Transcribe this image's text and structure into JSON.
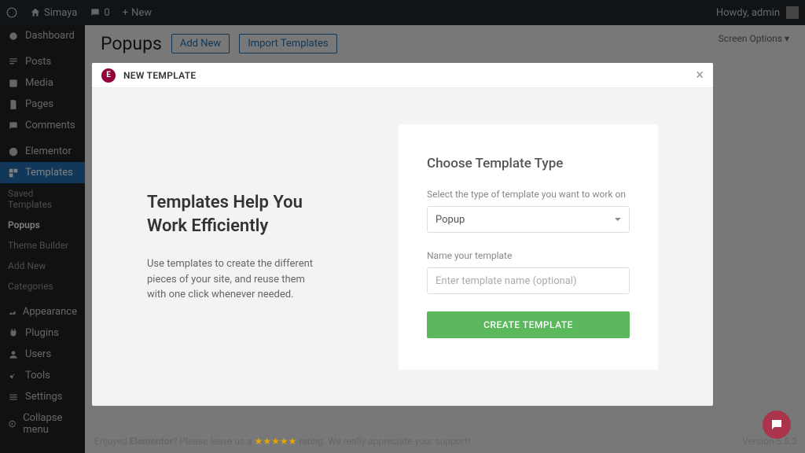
{
  "topbar": {
    "site_name": "Simaya",
    "comments_count": "0",
    "new_label": "New",
    "howdy": "Howdy, admin"
  },
  "sidebar": {
    "dashboard": "Dashboard",
    "posts": "Posts",
    "media": "Media",
    "pages": "Pages",
    "comments": "Comments",
    "elementor": "Elementor",
    "templates": "Templates",
    "saved_templates": "Saved Templates",
    "popups": "Popups",
    "theme_builder": "Theme Builder",
    "add_new": "Add New",
    "categories": "Categories",
    "appearance": "Appearance",
    "plugins": "Plugins",
    "users": "Users",
    "tools": "Tools",
    "settings": "Settings",
    "collapse": "Collapse menu"
  },
  "page": {
    "title": "Popups",
    "add_new": "Add New",
    "import": "Import Templates",
    "screen_options": "Screen Options"
  },
  "modal": {
    "header": "NEW TEMPLATE",
    "left_heading_1": "Templates Help You",
    "left_heading_2": "Work Efficiently",
    "left_desc": "Use templates to create the different pieces of your site, and reuse them with one click whenever needed.",
    "form_heading": "Choose Template Type",
    "type_label": "Select the type of template you want to work on",
    "type_value": "Popup",
    "name_label": "Name your template",
    "name_placeholder": "Enter template name (optional)",
    "create_btn": "CREATE TEMPLATE"
  },
  "footer": {
    "text_1": "Enjoyed ",
    "brand": "Elementor",
    "text_2": "? Please leave us a ",
    "stars": "★★★★★",
    "text_3": " rating. We really appreciate your support!",
    "version": "Version 5.5.3"
  }
}
